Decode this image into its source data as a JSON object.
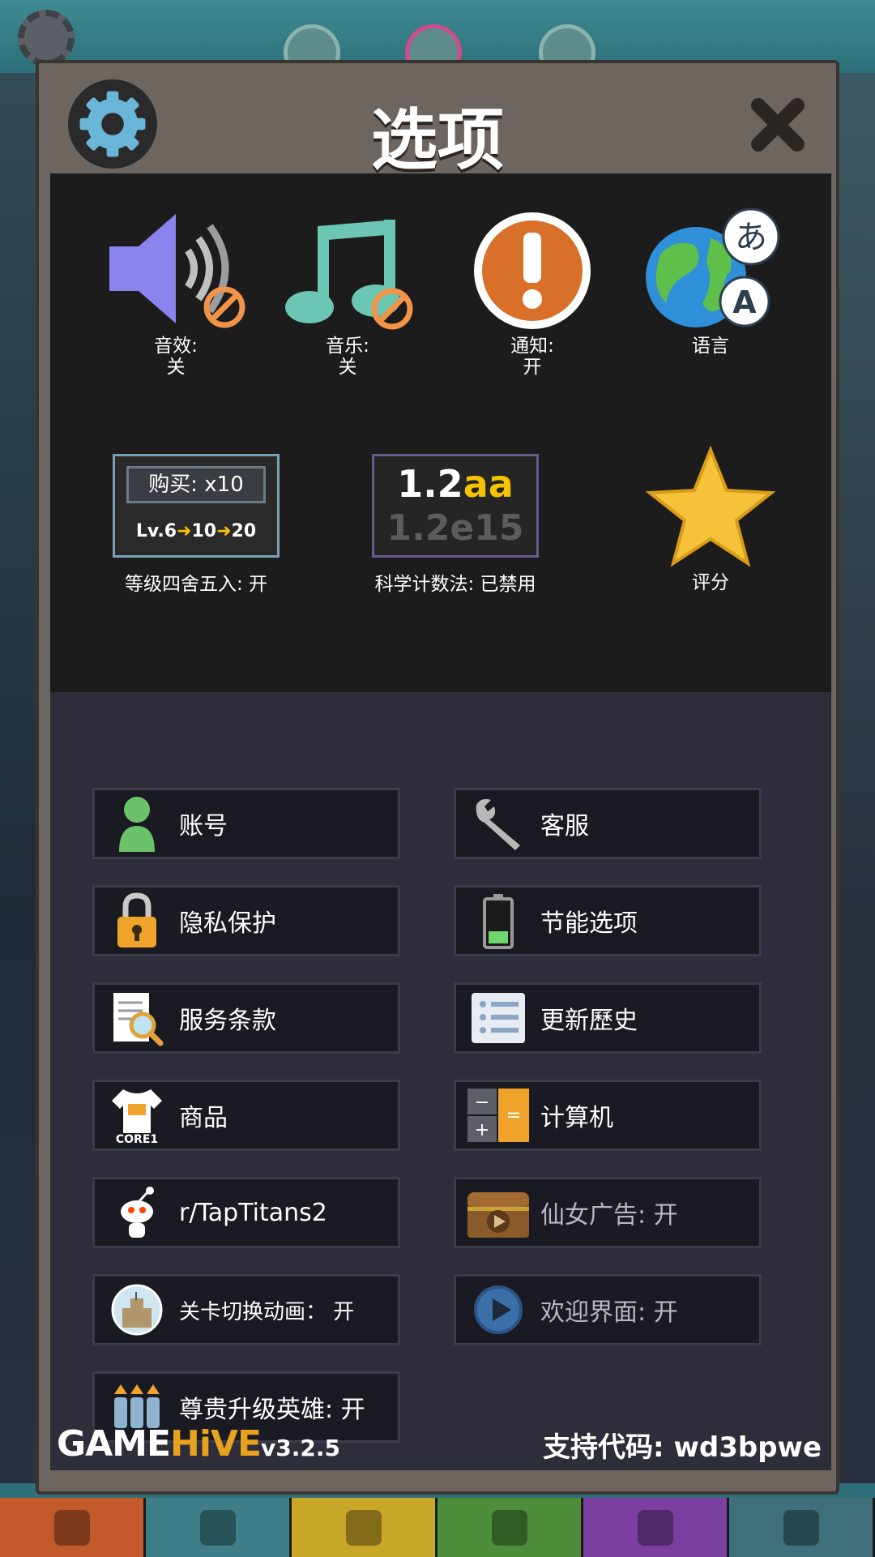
{
  "dialog": {
    "title": "选项"
  },
  "settings_icons": [
    {
      "label": "音效:",
      "value": "关",
      "icon": "speaker-muted-icon"
    },
    {
      "label": "音乐:",
      "value": "关",
      "icon": "music-note-muted-icon"
    },
    {
      "label": "通知:",
      "value": "开",
      "icon": "exclamation-icon"
    },
    {
      "label": "语言",
      "value": "",
      "icon": "globe-language-icon"
    }
  ],
  "round_levels": {
    "buy_label": "购买: x10",
    "lv_text": "Lv.6",
    "step1": "10",
    "step2": "20",
    "caption": "等级四舍五入: 开"
  },
  "scientific": {
    "big_num": "1.2",
    "big_suffix": "aa",
    "dim_text": "1.2e15",
    "caption": "科学计数法: 已禁用"
  },
  "rate": {
    "caption": "评分"
  },
  "menu": {
    "account": "账号",
    "support": "客服",
    "privacy": "隐私保护",
    "power_saving": "节能选项",
    "terms": "服务条款",
    "update_history": "更新歷史",
    "merch": "商品",
    "merch_shirt_text": "CORE1",
    "calculator": "计算机",
    "reddit": "r/TapTitans2",
    "fairy_ads": "仙女广告: 开",
    "stage_transition": "关卡切换动画： 开",
    "welcome_screen": "欢迎界面: 开",
    "vip_hero_upgrade": "尊贵升级英雄: 开"
  },
  "footer": {
    "logo_game": "GAME",
    "logo_hive": "HiVE",
    "version": "v3.2.5",
    "support_code": "支持代码: wd3bpwe"
  },
  "colors": {
    "accent_orange": "#e8a21e",
    "panel_dark": "#1c1c1c",
    "panel_blue": "#2d2e3a",
    "frame": "#6d6560"
  },
  "tabs": [
    "sword-icon",
    "hero-icon",
    "shirt-icon",
    "pet-icon",
    "artifact-icon",
    "shop-icon"
  ]
}
